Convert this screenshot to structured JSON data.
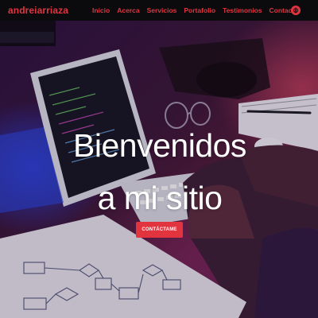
{
  "navbar": {
    "brand": "andreiarriaza",
    "links": [
      "Inicio",
      "Acerca",
      "Servicios",
      "Portafolio",
      "Testimonios",
      "Contacto"
    ],
    "toggle_icon": "circle-menu-icon"
  },
  "hero": {
    "title_line1": "Bienvenidos",
    "title_line2": "a mi sitio",
    "cta_label": "CONTÁCTAME"
  },
  "colors": {
    "accent": "#e2343f",
    "navbar_bg": "#0b0b0e",
    "hero_text": "#ffffff"
  }
}
